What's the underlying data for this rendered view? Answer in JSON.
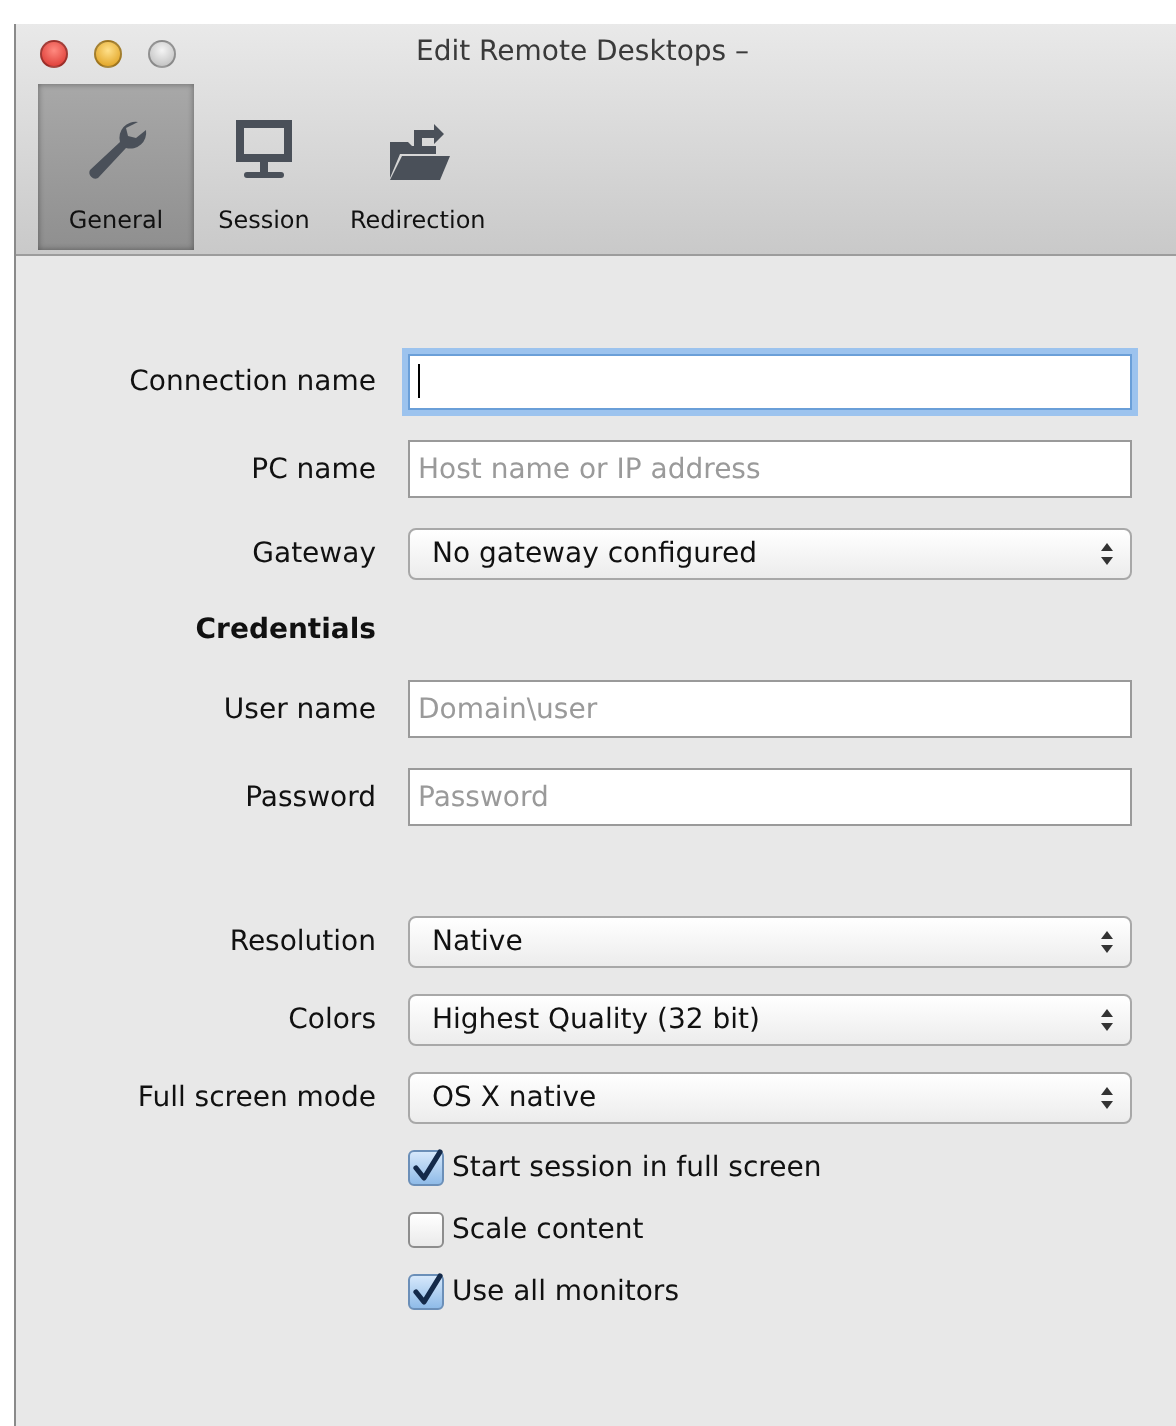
{
  "window": {
    "title": "Edit Remote Desktops –"
  },
  "toolbar": [
    {
      "label": "General",
      "kind": "wrench",
      "selected": true
    },
    {
      "label": "Session",
      "kind": "monitor",
      "selected": false
    },
    {
      "label": "Redirection",
      "kind": "folder",
      "selected": false
    }
  ],
  "form": {
    "groups": [
      {
        "rows": [
          {
            "kind": "text",
            "label": "Connection name",
            "focused": true
          },
          {
            "kind": "text",
            "label": "PC name",
            "placeholder": "Host name or IP address",
            "focused": false
          },
          {
            "kind": "select",
            "label": "Gateway",
            "value": "No gateway configured"
          },
          {
            "kind": "heading",
            "label": "Credentials"
          },
          {
            "kind": "text",
            "label": "User name",
            "placeholder": "Domain\\user",
            "focused": false
          },
          {
            "kind": "text",
            "label": "Password",
            "placeholder": "Password",
            "focused": false
          }
        ]
      },
      {
        "rows": [
          {
            "kind": "select",
            "label": "Resolution",
            "value": "Native"
          },
          {
            "kind": "select",
            "label": "Colors",
            "value": "Highest Quality (32 bit)"
          },
          {
            "kind": "select",
            "label": "Full screen mode",
            "value": "OS X native"
          },
          {
            "kind": "checkbox",
            "label": "Start session in full screen",
            "checked": true
          },
          {
            "kind": "checkbox",
            "label": "Scale content",
            "checked": false
          },
          {
            "kind": "checkbox",
            "label": "Use all monitors",
            "checked": true
          }
        ]
      }
    ]
  }
}
